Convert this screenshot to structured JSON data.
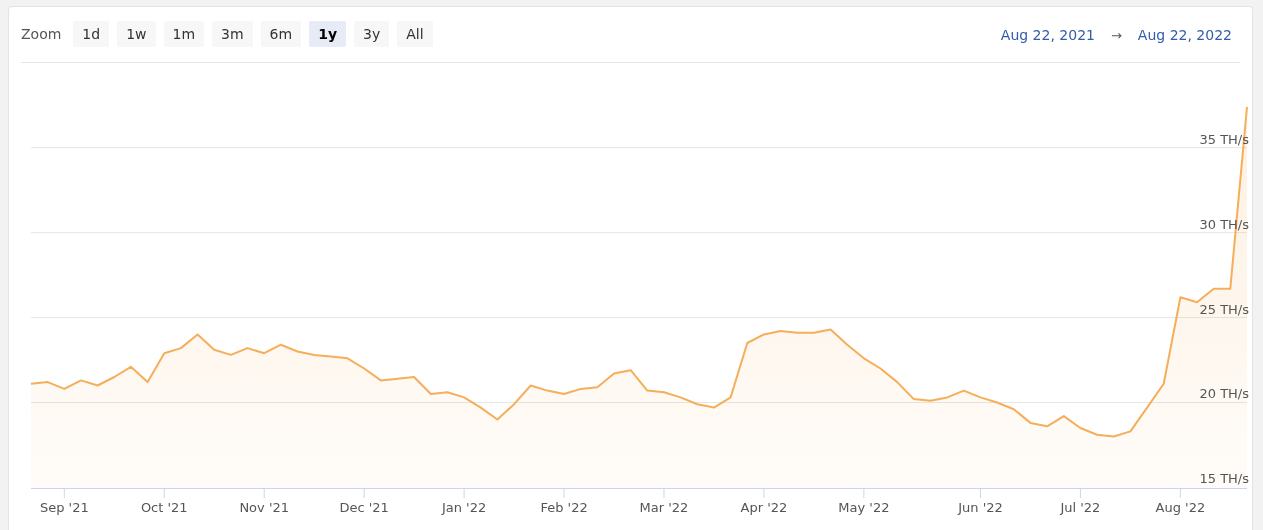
{
  "toolbar": {
    "zoom_label": "Zoom",
    "ranges": [
      {
        "label": "1d",
        "selected": false
      },
      {
        "label": "1w",
        "selected": false
      },
      {
        "label": "1m",
        "selected": false
      },
      {
        "label": "3m",
        "selected": false
      },
      {
        "label": "6m",
        "selected": false
      },
      {
        "label": "1y",
        "selected": true
      },
      {
        "label": "3y",
        "selected": false
      },
      {
        "label": "All",
        "selected": false
      }
    ],
    "date_from": "Aug 22, 2021",
    "date_separator": "→",
    "date_to": "Aug 22, 2022"
  },
  "chart": {
    "chart_data": {
      "type": "area",
      "grid": true,
      "ylim": [
        12.2,
        43.34
      ],
      "categories": [
        null,
        null,
        "Sep '21",
        null,
        null,
        null,
        null,
        null,
        "Oct '21",
        null,
        null,
        null,
        null,
        null,
        "Nov '21",
        null,
        null,
        null,
        null,
        null,
        "Dec '21",
        null,
        null,
        null,
        null,
        null,
        "Jan '22",
        null,
        null,
        null,
        null,
        null,
        "Feb '22",
        null,
        null,
        null,
        null,
        null,
        "Mar '22",
        null,
        null,
        null,
        null,
        null,
        "Apr '22",
        null,
        null,
        null,
        null,
        null,
        "May '22",
        null,
        null,
        null,
        null,
        null,
        null,
        "Jun '22",
        null,
        null,
        null,
        null,
        null,
        "Jul '22",
        null,
        null,
        null,
        null,
        null,
        "Aug '22",
        null,
        null,
        null,
        null
      ],
      "yticks": [
        {
          "value": 15,
          "label": "15 TH/s"
        },
        {
          "value": 20,
          "label": "20 TH/s"
        },
        {
          "value": 25,
          "label": "25 TH/s"
        },
        {
          "value": 30,
          "label": "30 TH/s"
        },
        {
          "value": 35,
          "label": "35 TH/s"
        }
      ],
      "series": [
        {
          "color": "#f5ae5a",
          "values": [
            21.1,
            21.2,
            20.8,
            21.3,
            21.0,
            21.5,
            22.1,
            21.2,
            22.9,
            23.2,
            24.0,
            23.1,
            22.8,
            23.2,
            22.9,
            23.4,
            23.0,
            22.8,
            22.7,
            22.6,
            22.0,
            21.3,
            21.4,
            21.5,
            20.5,
            20.6,
            20.3,
            19.7,
            19.0,
            19.9,
            21.0,
            20.7,
            20.5,
            20.8,
            20.9,
            21.7,
            21.9,
            20.7,
            20.6,
            20.3,
            19.9,
            19.7,
            20.3,
            23.5,
            24.0,
            24.2,
            24.1,
            24.1,
            24.3,
            23.4,
            22.6,
            22.0,
            21.2,
            20.2,
            20.1,
            20.3,
            20.7,
            20.3,
            20.0,
            19.6,
            18.8,
            18.6,
            19.2,
            18.5,
            18.1,
            18.0,
            18.3,
            19.7,
            21.1,
            26.2,
            25.9,
            26.7,
            26.7,
            37.4
          ]
        }
      ]
    }
  }
}
